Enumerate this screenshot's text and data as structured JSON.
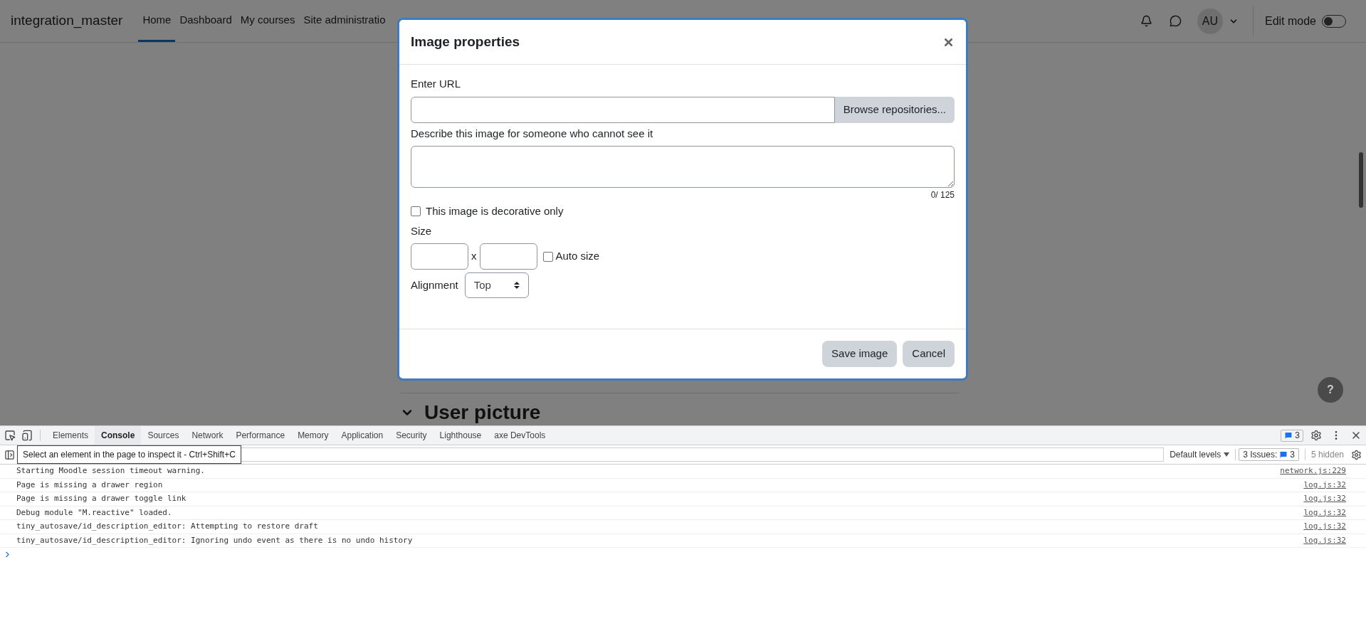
{
  "nav": {
    "site_name": "integration_master",
    "items": [
      {
        "label": "Home",
        "selected": true
      },
      {
        "label": "Dashboard",
        "selected": false
      },
      {
        "label": "My courses",
        "selected": false
      },
      {
        "label": "Site administratio",
        "selected": false
      }
    ],
    "avatar_initials": "AU",
    "edit_mode": {
      "label": "Edit mode",
      "on": false
    }
  },
  "page": {
    "section_heading": "User picture",
    "help_button": "?"
  },
  "modal": {
    "title": "Image properties",
    "url_label": "Enter URL",
    "browse_button": "Browse repositories...",
    "description_label": "Describe this image for someone who cannot see it",
    "counter": "0/ 125",
    "decorative": {
      "label": "This image is decorative only",
      "checked": false
    },
    "size_label": "Size",
    "size_separator": "x",
    "auto_size": {
      "label": "Auto size",
      "checked": false
    },
    "alignment_label": "Alignment",
    "alignment_value": "Top",
    "buttons": [
      "Save image",
      "Cancel"
    ]
  },
  "devtools": {
    "tabs": [
      {
        "label": "Elements",
        "selected": false
      },
      {
        "label": "Console",
        "selected": true
      },
      {
        "label": "Sources",
        "selected": false
      },
      {
        "label": "Network",
        "selected": false
      },
      {
        "label": "Performance",
        "selected": false
      },
      {
        "label": "Memory",
        "selected": false
      },
      {
        "label": "Application",
        "selected": false
      },
      {
        "label": "Security",
        "selected": false
      },
      {
        "label": "Lighthouse",
        "selected": false
      },
      {
        "label": "axe DevTools",
        "selected": false
      }
    ],
    "message_badge": "3",
    "tooltip": "Select an element in the page to inspect it - Ctrl+Shift+C",
    "levels": "Default levels",
    "issues_label": "3 Issues:",
    "issues_count": "3",
    "hidden": "5 hidden",
    "messages": [
      {
        "text": "Starting Moodle session timeout warning.",
        "source": "network.js:229"
      },
      {
        "text": "Page is missing a drawer region",
        "source": "log.js:32"
      },
      {
        "text": "Page is missing a drawer toggle link",
        "source": "log.js:32"
      },
      {
        "text": "Debug module \"M.reactive\" loaded.",
        "source": "log.js:32"
      },
      {
        "text": "tiny_autosave/id_description_editor: Attempting to restore draft",
        "source": "log.js:32"
      },
      {
        "text": "tiny_autosave/id_description_editor: Ignoring undo event as there is no undo history",
        "source": "log.js:32"
      }
    ]
  }
}
